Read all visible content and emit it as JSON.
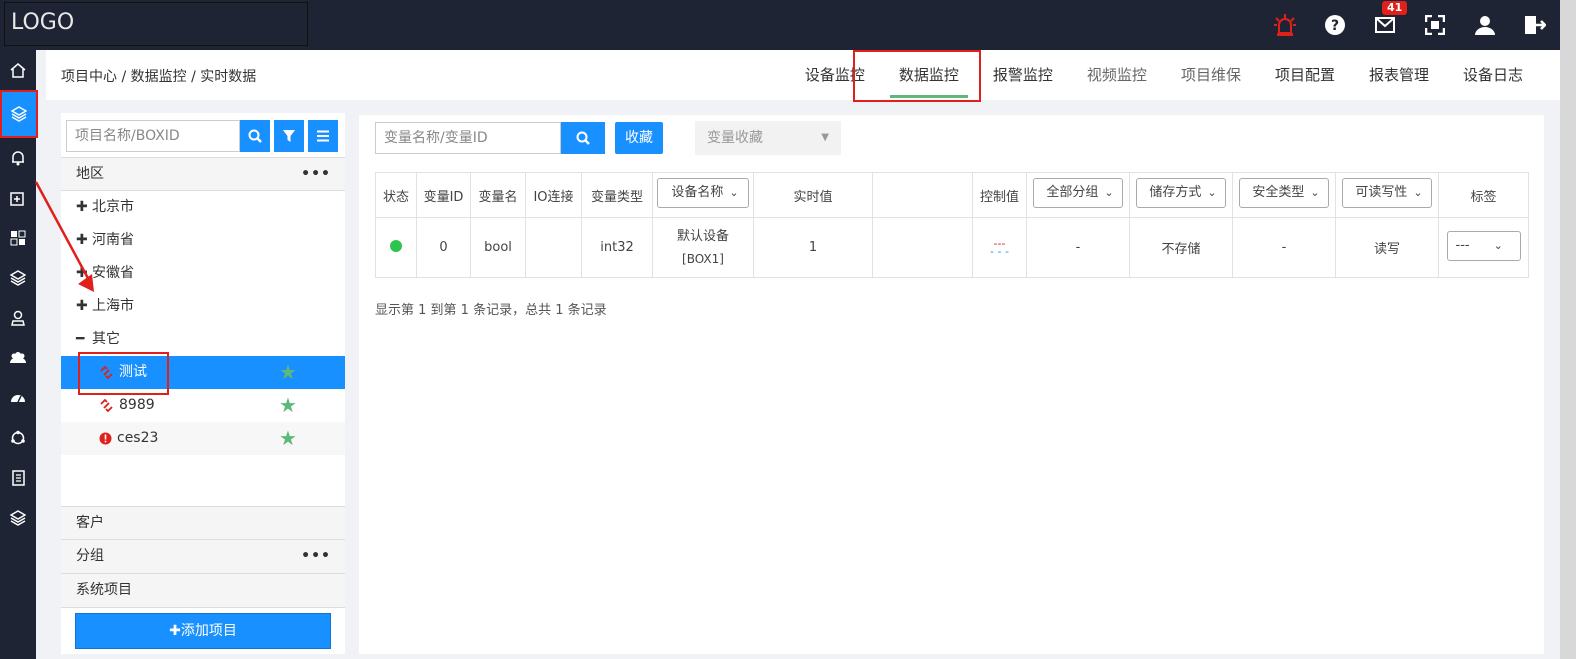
{
  "app": {
    "logo": "LOGO"
  },
  "topbar": {
    "mail_badge": "41"
  },
  "breadcrumb": "项目中心 / 数据监控 / 实时数据",
  "tabs": [
    {
      "label": "设备监控"
    },
    {
      "label": "数据监控"
    },
    {
      "label": "报警监控"
    },
    {
      "label": "视频监控"
    },
    {
      "label": "项目维保"
    },
    {
      "label": "项目配置"
    },
    {
      "label": "报表管理"
    },
    {
      "label": "设备日志"
    }
  ],
  "left": {
    "search_placeholder": "项目名称/BOXID",
    "region_header": "地区",
    "regions": [
      {
        "label": "北京市"
      },
      {
        "label": "河南省"
      },
      {
        "label": "安徽省"
      },
      {
        "label": "上海市"
      },
      {
        "label": "其它"
      }
    ],
    "projects": [
      {
        "name": "测试"
      },
      {
        "name": "8989"
      },
      {
        "name": "ces23"
      }
    ],
    "customer_header": "客户",
    "group_header": "分组",
    "system_header": "系统项目",
    "add_button": "✚添加项目"
  },
  "main": {
    "var_search_placeholder": "变量名称/变量ID",
    "favorite_button": "收藏",
    "favorite_select": "变量收藏",
    "columns": {
      "status": "状态",
      "var_id": "变量ID",
      "var_name": "变量名",
      "io": "IO连接",
      "var_type": "变量类型",
      "device_name": "设备名称",
      "realtime": "实时值",
      "control": "控制值",
      "group": "全部分组",
      "storage": "储存方式",
      "security": "安全类型",
      "rw": "可读写性",
      "tag": "标签"
    },
    "rows": [
      {
        "var_id": "0",
        "var_name": "bool",
        "io": "",
        "var_type": "int32",
        "device": "默认设备",
        "box": "[BOX1]",
        "realtime": "1",
        "control": "---",
        "group": "-",
        "storage": "不存储",
        "security": "-",
        "rw": "读写",
        "tag": "---"
      }
    ],
    "footer": "显示第 1 到第 1 条记录，总共 1 条记录"
  }
}
